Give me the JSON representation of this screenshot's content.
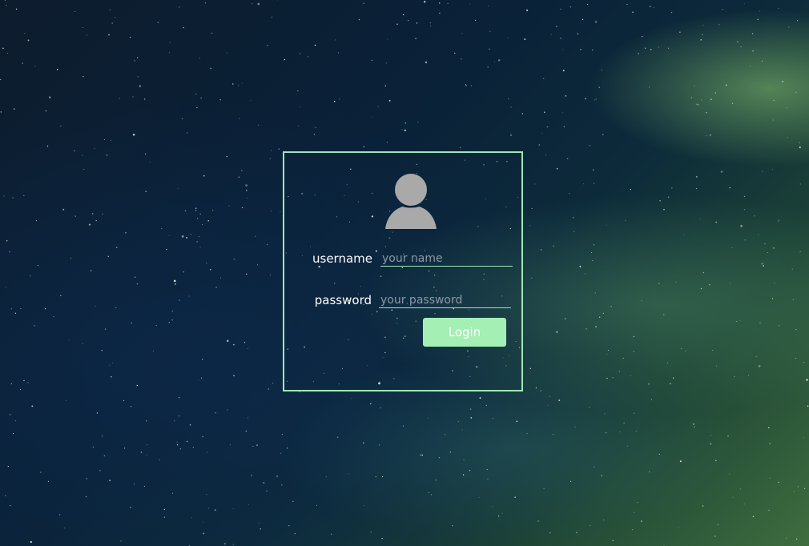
{
  "login_form": {
    "username_label": "username",
    "username_placeholder": "your name",
    "password_label": "password",
    "password_placeholder": "your password",
    "login_button_label": "Login"
  },
  "icons": {
    "avatar": "user-icon"
  },
  "colors": {
    "accent": "#9de8b2",
    "button_bg": "#a3efb4",
    "avatar_fill": "#a9a9a9",
    "label_text": "#ffffff",
    "placeholder_text": "#8b98a6"
  }
}
